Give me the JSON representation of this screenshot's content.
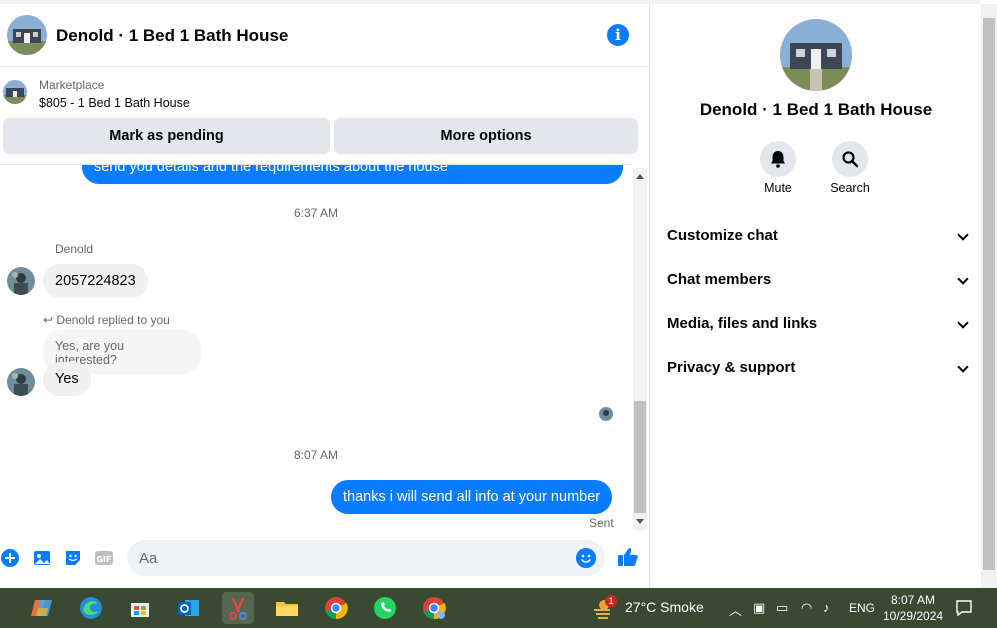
{
  "chat": {
    "title": "Denold · 1 Bed 1 Bath House",
    "marketplace_label": "Marketplace",
    "listing": "$805 - 1 Bed 1 Bath House",
    "mark_pending": "Mark as pending",
    "more_options": "More options"
  },
  "messages": {
    "top_partial": "send you details and the requirements about the house",
    "ts1": "6:37 AM",
    "sender1": "Denold",
    "msg1": "2057224823",
    "reply_note": "Denold replied to you",
    "reply_quote": "Yes, are you interested?",
    "msg2": "Yes",
    "ts2": "8:07 AM",
    "msg3": "thanks i will send all info at your number",
    "sent": "Sent"
  },
  "composer": {
    "placeholder": "Aa"
  },
  "panel": {
    "title": "Denold · 1 Bed 1 Bath House",
    "mute": "Mute",
    "search": "Search",
    "sections": [
      "Customize chat",
      "Chat members",
      "Media, files and links",
      "Privacy & support"
    ]
  },
  "taskbar": {
    "weather": "27°C  Smoke",
    "badge": "1",
    "lang": "ENG",
    "time": "8:07 AM",
    "date": "10/29/2024"
  },
  "colors": {
    "accent": "#0a7cff",
    "bubble_in": "#f0f0f0",
    "taskbar": "#3a4a32"
  }
}
